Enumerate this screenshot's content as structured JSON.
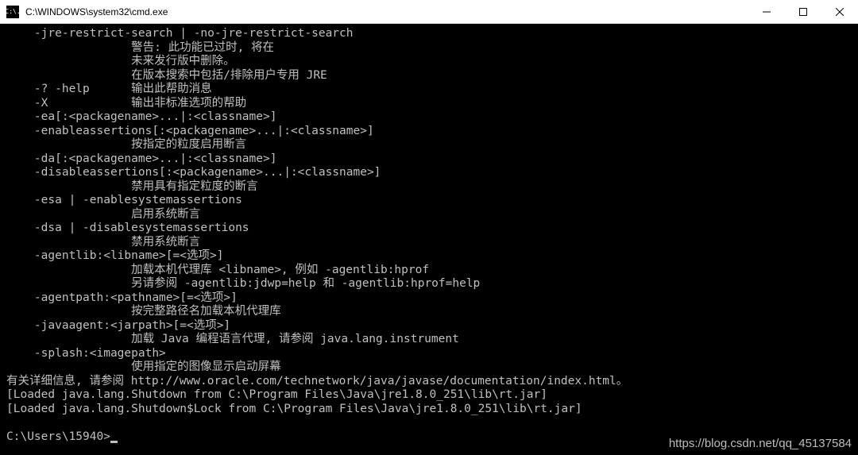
{
  "window": {
    "title": "C:\\WINDOWS\\system32\\cmd.exe",
    "icon_text": "C:\\."
  },
  "terminal": {
    "lines": [
      "    -jre-restrict-search | -no-jre-restrict-search",
      "                  警告: 此功能已过时, 将在",
      "                  未来发行版中删除。",
      "                  在版本搜索中包括/排除用户专用 JRE",
      "    -? -help      输出此帮助消息",
      "    -X            输出非标准选项的帮助",
      "    -ea[:<packagename>...|:<classname>]",
      "    -enableassertions[:<packagename>...|:<classname>]",
      "                  按指定的粒度启用断言",
      "    -da[:<packagename>...|:<classname>]",
      "    -disableassertions[:<packagename>...|:<classname>]",
      "                  禁用具有指定粒度的断言",
      "    -esa | -enablesystemassertions",
      "                  启用系统断言",
      "    -dsa | -disablesystemassertions",
      "                  禁用系统断言",
      "    -agentlib:<libname>[=<选项>]",
      "                  加载本机代理库 <libname>, 例如 -agentlib:hprof",
      "                  另请参阅 -agentlib:jdwp=help 和 -agentlib:hprof=help",
      "    -agentpath:<pathname>[=<选项>]",
      "                  按完整路径名加载本机代理库",
      "    -javaagent:<jarpath>[=<选项>]",
      "                  加载 Java 编程语言代理, 请参阅 java.lang.instrument",
      "    -splash:<imagepath>",
      "                  使用指定的图像显示启动屏幕",
      "有关详细信息, 请参阅 http://www.oracle.com/technetwork/java/javase/documentation/index.html。",
      "[Loaded java.lang.Shutdown from C:\\Program Files\\Java\\jre1.8.0_251\\lib\\rt.jar]",
      "[Loaded java.lang.Shutdown$Lock from C:\\Program Files\\Java\\jre1.8.0_251\\lib\\rt.jar]",
      "",
      "C:\\Users\\15940>"
    ]
  },
  "watermark": "https://blog.csdn.net/qq_45137584"
}
